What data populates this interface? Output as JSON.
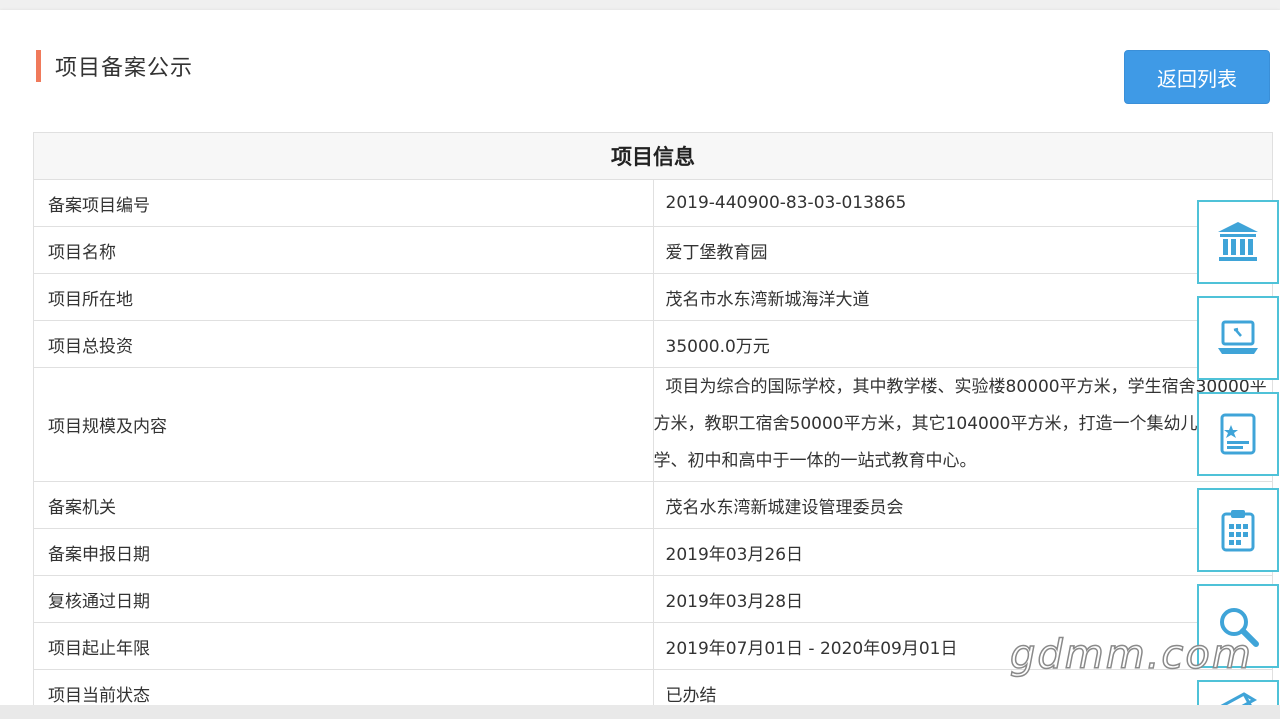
{
  "header": {
    "title": "项目备案公示",
    "back_label": "返回列表"
  },
  "table": {
    "heading": "项目信息",
    "rows": [
      {
        "label": "备案项目编号",
        "value": "2019-440900-83-03-013865"
      },
      {
        "label": "项目名称",
        "value": "爱丁堡教育园"
      },
      {
        "label": "项目所在地",
        "value": "茂名市水东湾新城海洋大道"
      },
      {
        "label": "项目总投资",
        "value": "35000.0万元"
      },
      {
        "label": "项目规模及内容",
        "value": "项目为综合的国际学校，其中教学楼、实验楼80000平方米，学生宿舍30000平方米，教职工宿舍50000平方米，其它104000平方米，打造一个集幼儿园、小学、初中和高中于一体的一站式教育中心。"
      },
      {
        "label": "备案机关",
        "value": "茂名水东湾新城建设管理委员会"
      },
      {
        "label": "备案申报日期",
        "value": "2019年03月26日"
      },
      {
        "label": "复核通过日期",
        "value": "2019年03月28日"
      },
      {
        "label": "项目起止年限",
        "value": "2019年07月01日 - 2020年09月01日"
      },
      {
        "label": "项目当前状态",
        "value": "已办结"
      }
    ]
  },
  "side_toolbar": {
    "icons": [
      "bank-icon",
      "laptop-icon",
      "certificate-icon",
      "clipboard-icon",
      "search-icon",
      "pen-icon"
    ]
  },
  "watermark": "gdmm.com",
  "colors": {
    "accent": "#f07a5b",
    "button": "#3f9ae6",
    "toolbar_border": "#4fc2d8",
    "toolbar_icon": "#3fa4d8"
  }
}
